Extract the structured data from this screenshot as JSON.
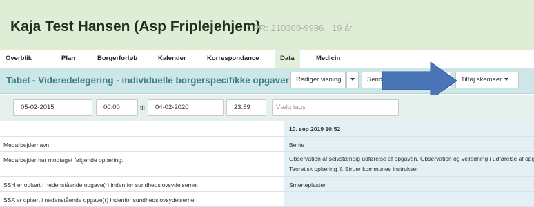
{
  "header": {
    "patient_name": "Kaja Test Hansen (Asp Friplejehjem)",
    "cpr": "CPR: 210300-9996",
    "age": "19 år"
  },
  "nav": {
    "tabs": [
      "Overblik",
      "Plan",
      "Borgerforløb",
      "Kalender",
      "Korrespondance",
      "Data",
      "Medicin"
    ],
    "active": "Data"
  },
  "titlebar": {
    "title": "Tabel - Videredelegering - individuelle borgerspecifikke opgaver",
    "edit_view_label": "Redigér visning",
    "send_label": "Send",
    "add_schema_label": "Tilføj skemaer"
  },
  "filters": {
    "from_date": "05-02-2015",
    "from_time": "00:00",
    "til_label": "til",
    "to_date": "04-02-2020",
    "to_time": "23:59",
    "tags_placeholder": "Vælg tags"
  },
  "table": {
    "column_header": "10. sep 2019 10:52",
    "rows": [
      {
        "label": "Medarbejdernavn",
        "value": "Bente"
      },
      {
        "label": "Medarbejder har modtaget følgende oplæring:",
        "value": "Observation af selvstændig udførelse af opgaven, Observation og vejledning i udførelse af opgaven, Teoretisk oplæring jf. Struer kommunes instrukser"
      },
      {
        "label": "SSH er oplært i nedenstående opgave(r) inden for sundhedslovsydelserne:",
        "value": "Smerteplaster"
      },
      {
        "label": "SSA er oplært i nedenstående opgave(r) indenfor sundhedslovsydelserne",
        "value": ""
      }
    ]
  },
  "colors": {
    "header_bg": "#dfecd6",
    "titlebar_bg": "#cde7e8",
    "title_text": "#3b7f86",
    "arrow_fill": "#4a76b8"
  },
  "icons": [
    "chevron-down-icon",
    "annotation-arrow-icon"
  ]
}
